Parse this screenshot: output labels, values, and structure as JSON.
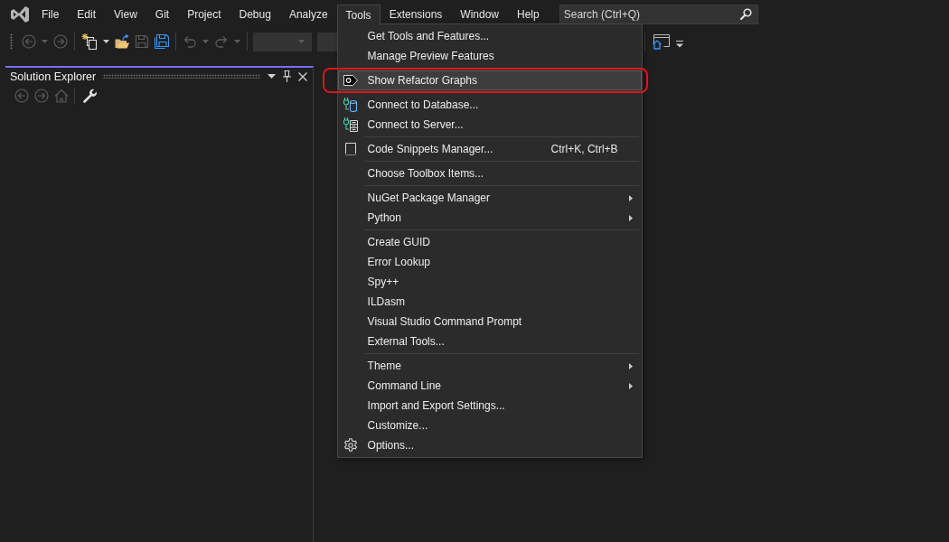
{
  "menu_bar": {
    "items": [
      {
        "label": "File",
        "selected": false
      },
      {
        "label": "Edit",
        "selected": false
      },
      {
        "label": "View",
        "selected": false
      },
      {
        "label": "Git",
        "selected": false
      },
      {
        "label": "Project",
        "selected": false
      },
      {
        "label": "Debug",
        "selected": false
      },
      {
        "label": "Analyze",
        "selected": false
      },
      {
        "label": "Tools",
        "selected": true
      },
      {
        "label": "Extensions",
        "selected": false
      },
      {
        "label": "Window",
        "selected": false
      },
      {
        "label": "Help",
        "selected": false
      }
    ]
  },
  "search": {
    "placeholder": "Search (Ctrl+Q)"
  },
  "toolbar": {
    "buttons": [
      {
        "disabled": true
      },
      {
        "disabled": true
      },
      {
        "disabled": false
      },
      {
        "disabled": false
      },
      {
        "disabled": true
      },
      {
        "disabled": false
      },
      {
        "disabled": true
      },
      {
        "disabled": true
      }
    ]
  },
  "tools_menu": {
    "sections": [
      {
        "items": [
          {
            "label": "Get Tools and Features...",
            "selected": false,
            "callout": false,
            "submenu": false
          },
          {
            "label": "Manage Preview Features",
            "selected": false,
            "callout": false,
            "submenu": false
          }
        ]
      },
      {
        "items": [
          {
            "label": "Show Refactor Graphs",
            "selected": true,
            "callout": true,
            "submenu": false
          }
        ]
      },
      {
        "items": [
          {
            "label": "Connect to Database...",
            "selected": false,
            "callout": false,
            "submenu": false
          },
          {
            "label": "Connect to Server...",
            "selected": false,
            "callout": false,
            "submenu": false
          }
        ]
      },
      {
        "items": [
          {
            "label": "Code Snippets Manager...",
            "shortcut": "Ctrl+K, Ctrl+B",
            "selected": false,
            "callout": false,
            "submenu": false
          }
        ]
      },
      {
        "items": [
          {
            "label": "Choose Toolbox Items...",
            "selected": false,
            "callout": false,
            "submenu": false
          }
        ]
      },
      {
        "items": [
          {
            "label": "NuGet Package Manager",
            "selected": false,
            "callout": false,
            "submenu": true
          },
          {
            "label": "Python",
            "selected": false,
            "callout": false,
            "submenu": true
          }
        ]
      },
      {
        "items": [
          {
            "label": "Create GUID",
            "selected": false,
            "callout": false,
            "submenu": false
          },
          {
            "label": "Error Lookup",
            "selected": false,
            "callout": false,
            "submenu": false
          },
          {
            "label": "Spy++",
            "selected": false,
            "callout": false,
            "submenu": false
          },
          {
            "label": "ILDasm",
            "selected": false,
            "callout": false,
            "submenu": false
          },
          {
            "label": "Visual Studio Command Prompt",
            "selected": false,
            "callout": false,
            "submenu": false
          },
          {
            "label": "External Tools...",
            "selected": false,
            "callout": false,
            "submenu": false
          }
        ]
      },
      {
        "items": [
          {
            "label": "Theme",
            "selected": false,
            "callout": false,
            "submenu": true
          },
          {
            "label": "Command Line",
            "selected": false,
            "callout": false,
            "submenu": true
          },
          {
            "label": "Import and Export Settings...",
            "selected": false,
            "callout": false,
            "submenu": false
          },
          {
            "label": "Customize...",
            "selected": false,
            "callout": false,
            "submenu": false
          },
          {
            "label": "Options...",
            "selected": false,
            "callout": false,
            "submenu": false
          }
        ]
      }
    ]
  },
  "solution_explorer": {
    "title": "Solution Explorer",
    "toolbar": [
      {
        "disabled": true
      },
      {
        "disabled": true
      },
      {
        "disabled": true
      },
      {
        "disabled": false
      }
    ]
  }
}
